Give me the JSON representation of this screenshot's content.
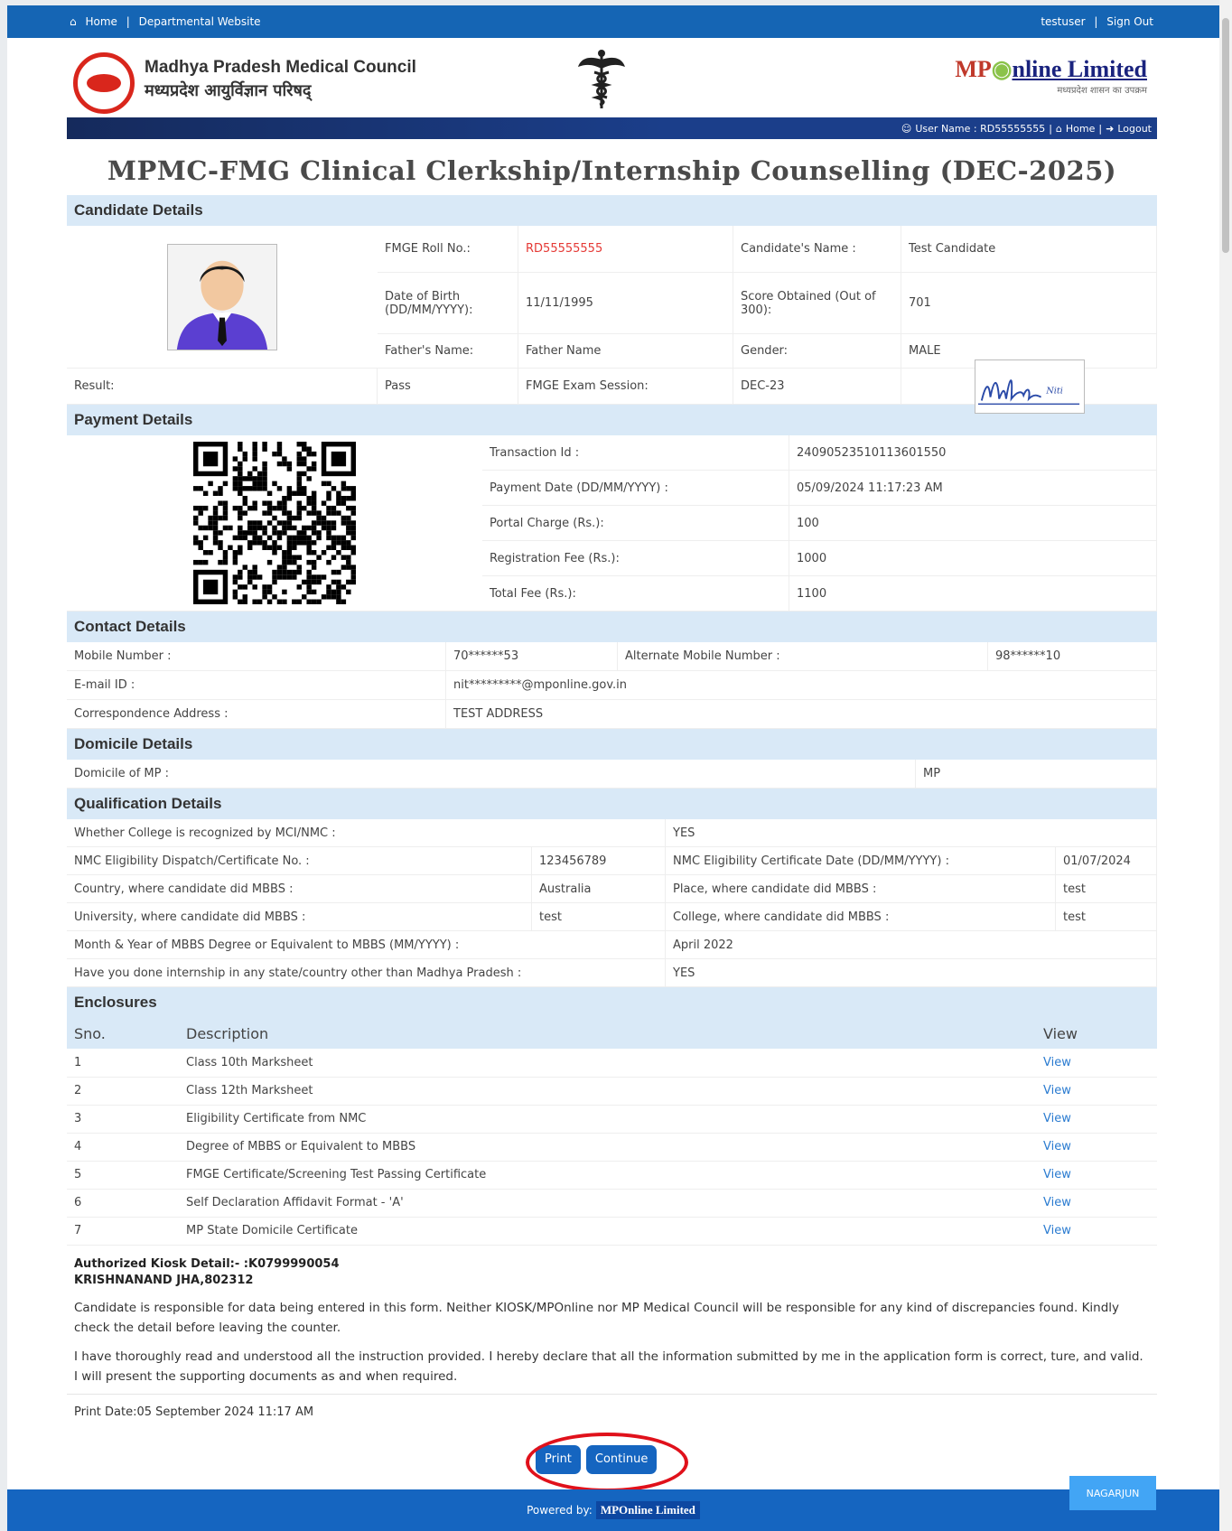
{
  "topbar": {
    "home": "Home",
    "sep1": "|",
    "dept": "Departmental Website",
    "user": "testuser",
    "sep2": "|",
    "signout": "Sign Out"
  },
  "header": {
    "council_en": "Madhya Pradesh Medical Council",
    "council_hi": "मध्यप्रदेश आयुर्विज्ञान परिषद्",
    "mponline_brand_a": "MP",
    "mponline_brand_b": "nline Limited",
    "mponline_tag": "मध्यप्रदेश शासन का उपक्रम"
  },
  "userbar": {
    "user_label": "User Name : RD55555555",
    "sep": "|",
    "home": "Home",
    "sep2": "|",
    "logout": "Logout"
  },
  "title": "MPMC-FMG Clinical Clerkship/Internship Counselling (DEC-2025)",
  "candidate": {
    "heading": "Candidate Details",
    "roll_label": "FMGE Roll No.:",
    "roll_value": "RD55555555",
    "name_label": "Candidate's Name :",
    "name_value": "Test Candidate",
    "dob_label": "Date of Birth (DD/MM/YYYY):",
    "dob_value": "11/11/1995",
    "score_label": "Score Obtained (Out of 300):",
    "score_value": "701",
    "father_label": "Father's Name:",
    "father_value": "Father Name",
    "gender_label": "Gender:",
    "gender_value": "MALE",
    "result_label": "Result:",
    "result_value": "Pass",
    "session_label": "FMGE Exam Session:",
    "session_value": "DEC-23"
  },
  "payment": {
    "heading": "Payment Details",
    "rows": [
      {
        "label": "Transaction Id :",
        "value": "24090523510113601550"
      },
      {
        "label": "Payment Date (DD/MM/YYYY) :",
        "value": "05/09/2024 11:17:23 AM"
      },
      {
        "label": "Portal Charge (Rs.):",
        "value": "100"
      },
      {
        "label": "Registration Fee (Rs.):",
        "value": "1000"
      },
      {
        "label": "Total Fee (Rs.):",
        "value": "1100"
      }
    ]
  },
  "contact": {
    "heading": "Contact Details",
    "mobile_label": "Mobile Number :",
    "mobile_value": "70******53",
    "alt_label": "Alternate Mobile Number :",
    "alt_value": "98******10",
    "email_label": "E-mail ID :",
    "email_value": "nit*********@mponline.gov.in",
    "addr_label": "Correspondence Address :",
    "addr_value": "TEST ADDRESS"
  },
  "domicile": {
    "heading": "Domicile Details",
    "label": "Domicile of MP :",
    "value": "MP"
  },
  "qualification": {
    "heading": "Qualification Details",
    "recognized_label": "Whether College is recognized by MCI/NMC :",
    "recognized_value": "YES",
    "cert_no_label": "NMC Eligibility Dispatch/Certificate No. :",
    "cert_no_value": "123456789",
    "cert_date_label": "NMC Eligibility Certificate Date (DD/MM/YYYY) :",
    "cert_date_value": "01/07/2024",
    "country_label": "Country, where candidate did MBBS :",
    "country_value": "Australia",
    "place_label": "Place, where candidate did MBBS :",
    "place_value": "test",
    "university_label": "University, where candidate did MBBS :",
    "university_value": "test",
    "college_label": "College, where candidate did MBBS :",
    "college_value": "test",
    "month_label": "Month & Year of MBBS Degree or Equivalent to MBBS (MM/YYYY) :",
    "month_value": "April 2022",
    "internship_label": "Have you done internship in any state/country other than Madhya Pradesh :",
    "internship_value": "YES"
  },
  "enclosures": {
    "heading": "Enclosures",
    "col_sno": "Sno.",
    "col_desc": "Description",
    "col_view": "View",
    "rows": [
      {
        "sno": "1",
        "desc": "Class 10th Marksheet",
        "view": "View"
      },
      {
        "sno": "2",
        "desc": "Class 12th Marksheet",
        "view": "View"
      },
      {
        "sno": "3",
        "desc": "Eligibility Certificate from NMC",
        "view": "View"
      },
      {
        "sno": "4",
        "desc": "Degree of MBBS or Equivalent to MBBS",
        "view": "View"
      },
      {
        "sno": "5",
        "desc": "FMGE Certificate/Screening Test Passing Certificate",
        "view": "View"
      },
      {
        "sno": "6",
        "desc": "Self Declaration Affidavit Format - 'A'",
        "view": "View"
      },
      {
        "sno": "7",
        "desc": "MP State Domicile Certificate",
        "view": "View"
      }
    ]
  },
  "kiosk": {
    "line1": "Authorized Kiosk Detail:- :K0799990054",
    "line2": "KRISHNANAND JHA,802312"
  },
  "disclaimer": "Candidate is responsible for data being entered in this form. Neither KIOSK/MPOnline nor MP Medical Council will be responsible for any kind of discrepancies found. Kindly check the detail before leaving the counter.",
  "declaration": "I have thoroughly read and understood all the instruction provided. I hereby declare that all the information submitted by me in the application form is correct, ture, and valid. I will present the supporting documents as and when required.",
  "print_date": "Print Date:05 September 2024 11:17 AM",
  "buttons": {
    "print": "Print",
    "continue": "Continue"
  },
  "footer": {
    "powered": "Powered by:",
    "brand": "MPOnline Limited"
  },
  "nagarjun": "NAGARJUN",
  "signature_text": "Niti"
}
